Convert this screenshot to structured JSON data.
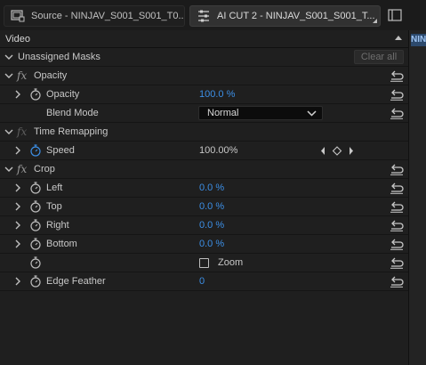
{
  "tabs": [
    {
      "label": "Source - NINJAV_S001_S001_T0...",
      "icon": "source-monitor-icon"
    },
    {
      "label": "AI CUT 2 - NINJAV_S001_S001_T...",
      "icon": "effect-controls-icon"
    }
  ],
  "right_panel_label": "NIN",
  "section": {
    "title": "Video"
  },
  "unassigned_masks": {
    "label": "Unassigned Masks",
    "clear_label": "Clear all"
  },
  "opacity_group": {
    "label": "Opacity",
    "opacity": {
      "label": "Opacity",
      "value": "100.0 %"
    },
    "blend_mode": {
      "label": "Blend Mode",
      "value": "Normal"
    }
  },
  "time_remapping": {
    "label": "Time Remapping",
    "speed": {
      "label": "Speed",
      "value": "100.00%"
    }
  },
  "crop": {
    "label": "Crop",
    "left": {
      "label": "Left",
      "value": "0.0 %"
    },
    "top": {
      "label": "Top",
      "value": "0.0 %"
    },
    "right": {
      "label": "Right",
      "value": "0.0 %"
    },
    "bottom": {
      "label": "Bottom",
      "value": "0.0 %"
    },
    "zoom": {
      "label": "Zoom",
      "checked": false
    },
    "edge_feather": {
      "label": "Edge Feather",
      "value": "0"
    }
  },
  "colors": {
    "value_blue": "#3c8fe6",
    "panel_bg": "#1f1f1f",
    "stopwatch_active": "#3c8fe6"
  }
}
